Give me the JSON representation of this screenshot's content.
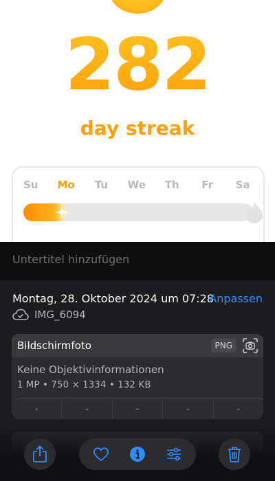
{
  "streak": {
    "count": "282",
    "label": "day streak",
    "days": [
      "Su",
      "Mo",
      "Tu",
      "We",
      "Th",
      "Fr",
      "Sa"
    ],
    "active_day": "Mo",
    "progress_fraction": 0.19
  },
  "info": {
    "caption_placeholder": "Untertitel hinzufügen",
    "date": "Montag, 28. Oktober 2024 um 07:28",
    "adjust_label": "Anpassen",
    "filename": "IMG_6094",
    "card_title": "Bildschirmfoto",
    "format_badge": "PNG",
    "lens": "Keine Objektivinformationen",
    "specs": "1 MP  •  750 × 1334  •  132 KB",
    "exif": [
      "-",
      "-",
      "-",
      "-",
      "-"
    ]
  },
  "toolbar": {
    "icons": [
      "share-icon",
      "heart-icon",
      "info-icon",
      "adjust-icon",
      "trash-icon"
    ]
  },
  "colors": {
    "streak_orange": "#ff9f0a",
    "ios_blue": "#2f8cff"
  }
}
